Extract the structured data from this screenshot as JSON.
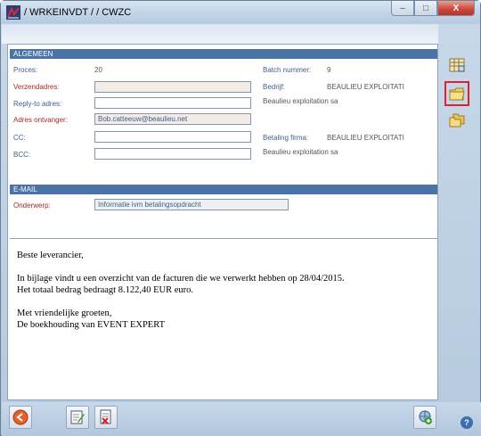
{
  "window": {
    "title": "/ WRKEINVDT /  / CWZC",
    "minimize": "–",
    "maximize": "□",
    "close": "X"
  },
  "algemeen": {
    "header": "ALGEMEEN",
    "proces_label": "Proces:",
    "proces_value": "20",
    "verzendadres_label": "Verzendadres:",
    "verzendadres_value": "",
    "replyto_label": "Reply-to adres:",
    "replyto_value": "",
    "ontvanger_label": "Adres ontvanger:",
    "ontvanger_value": "Bob.catteeuw@beaulieu.net",
    "cc_label": "CC:",
    "cc_value": "",
    "bcc_label": "BCC:",
    "bcc_value": "",
    "batch_label": "Batch nummer:",
    "batch_value": "9",
    "bedrijf_label": "Bedrijf:",
    "bedrijf_value": "BEAULIEU EXPLOITATI",
    "bedrijf_name": "Beaulieu exploitation sa",
    "betaling_label": "Betaling firma:",
    "betaling_value": "BEAULIEU EXPLOITATI",
    "betaling_name": "Beaulieu exploitation sa"
  },
  "email": {
    "header": "E-MAIL",
    "onderwerp_label": "Onderwerp:",
    "onderwerp_value": "Informatie ivm betalingsopdracht"
  },
  "body": {
    "line1": "Beste leverancier,",
    "line2": "In bijlage vindt u een overzicht van de facturen die we verwerkt hebben op 28/04/2015.",
    "line3": "Het totaal bedrag bedraagt 8.122,40 EUR euro.",
    "line4": "Met vriendelijke groeten,",
    "line5": "De boekhouding van EVENT EXPERT"
  },
  "help": "?",
  "colors": {
    "accent_red": "#e0202c",
    "section_blue": "#4a73a8",
    "label_blue": "#3f5f8a",
    "required_red": "#a62a2a"
  },
  "icons": [
    "app-logo-icon",
    "grid-calculator-icon",
    "folder-icon",
    "folders-icon",
    "back-arrow-icon",
    "edit-note-icon",
    "delete-document-icon",
    "add-globe-icon",
    "help-icon"
  ]
}
